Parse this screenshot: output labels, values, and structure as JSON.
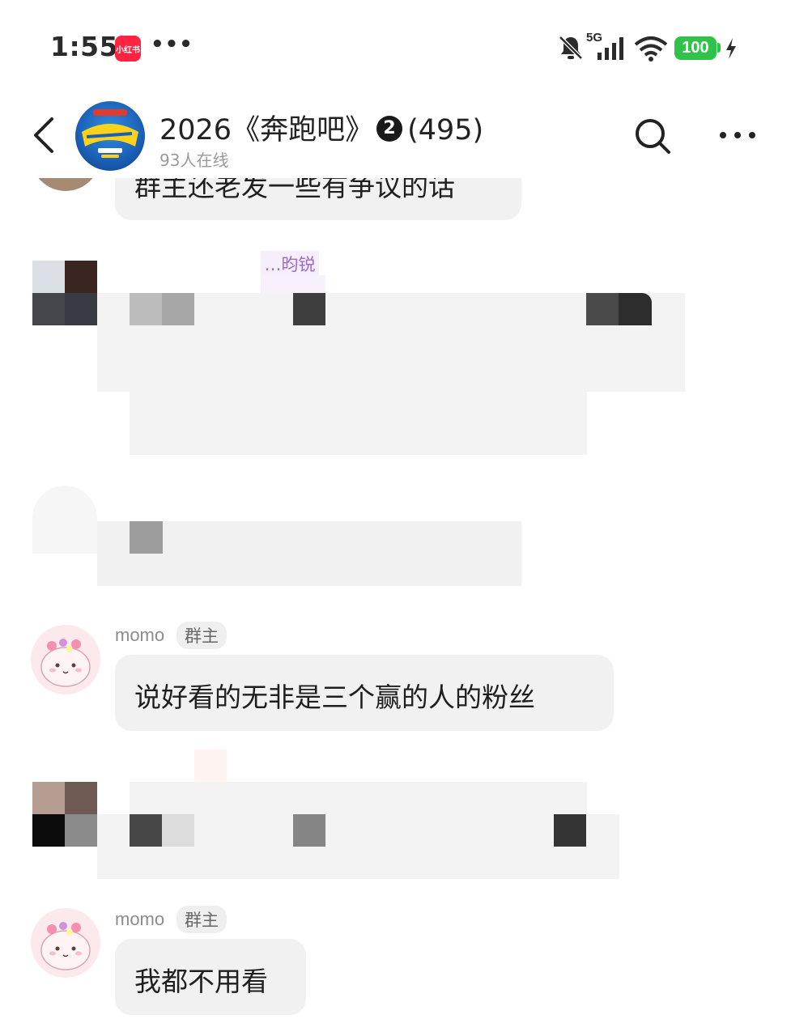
{
  "status_bar": {
    "time": "1:55",
    "app_badge": "小红书",
    "overflow": "•••",
    "network": "5G",
    "battery": "100"
  },
  "header": {
    "title_prefix": "2026《奔跑吧》",
    "title_badge": "2",
    "title_count": "(495)",
    "online": "93人在线",
    "icons": [
      "back-arrow-icon",
      "search-icon",
      "more-icon"
    ]
  },
  "messages": [
    {
      "text": "群主还老发一些有争议的话",
      "partial": true
    },
    {
      "sender": "…昀锐",
      "redacted": true
    },
    {
      "redacted": true
    },
    {
      "sender": "momo",
      "role": "群主",
      "text": "说好看的无非是三个赢的人的粉丝"
    },
    {
      "redacted": true
    },
    {
      "sender": "momo",
      "role": "群主",
      "text": "我都不用看"
    }
  ],
  "colors": {
    "bubble": "#f1f1f1",
    "battery": "#2fc34a",
    "app_badge": "#ff2442",
    "background": "#ffffff"
  }
}
